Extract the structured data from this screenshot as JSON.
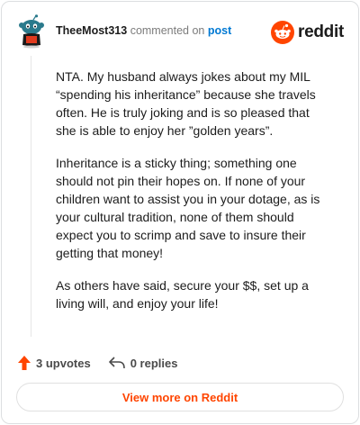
{
  "header": {
    "username": "TheeMost313",
    "verb": "commented on",
    "post_link": "post",
    "brand": "reddit"
  },
  "comment": {
    "paragraphs": [
      "NTA. My husband always jokes about my MIL “spending his inheritance” because she travels often. He is truly joking and is so pleased that she is able to enjoy her ”golden years”.",
      "Inheritance is a sticky thing; something one should not pin their hopes on. If none of your children want to assist you in your dotage, as is your cultural tradition, none of them should expect you to scrimp and save to insure their getting that money!",
      "As others have said, secure your $$, set up a living will, and enjoy your life!"
    ]
  },
  "actions": {
    "upvotes": "3 upvotes",
    "replies": "0 replies"
  },
  "footer": {
    "view_more": "View more on Reddit"
  },
  "colors": {
    "accent": "#ff4500",
    "link": "#0079d3"
  }
}
